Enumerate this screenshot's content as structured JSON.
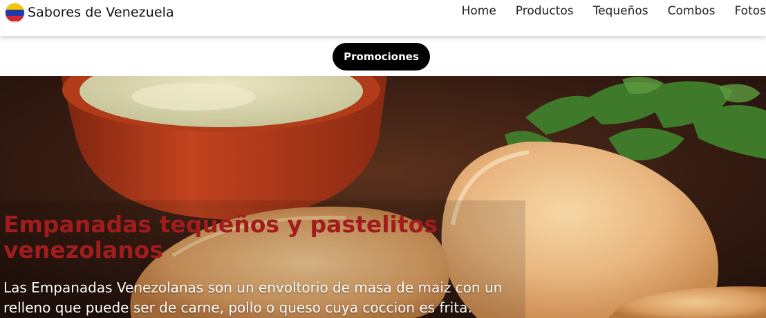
{
  "brand": {
    "title": "Sabores de Venezuela",
    "logo_icon": "venezuela-flag-logo-icon"
  },
  "nav": {
    "items": [
      {
        "label": "Home"
      },
      {
        "label": "Productos"
      },
      {
        "label": "Tequeños"
      },
      {
        "label": "Combos"
      },
      {
        "label": "Fotos"
      }
    ]
  },
  "promo": {
    "label": "Promociones"
  },
  "hero": {
    "title": "Empanadas tequeños y pastelitos venezolanos",
    "text": "Las Empanadas Venezolanas son un envoltorio de masa de maiz con un relleno que puede ser de carne, pollo o queso cuya coccion es frita.",
    "image_icon": "empanadas-photo"
  },
  "colors": {
    "title_red": "#a11c1c",
    "button_bg": "#000000",
    "header_bg": "#ffffff"
  }
}
